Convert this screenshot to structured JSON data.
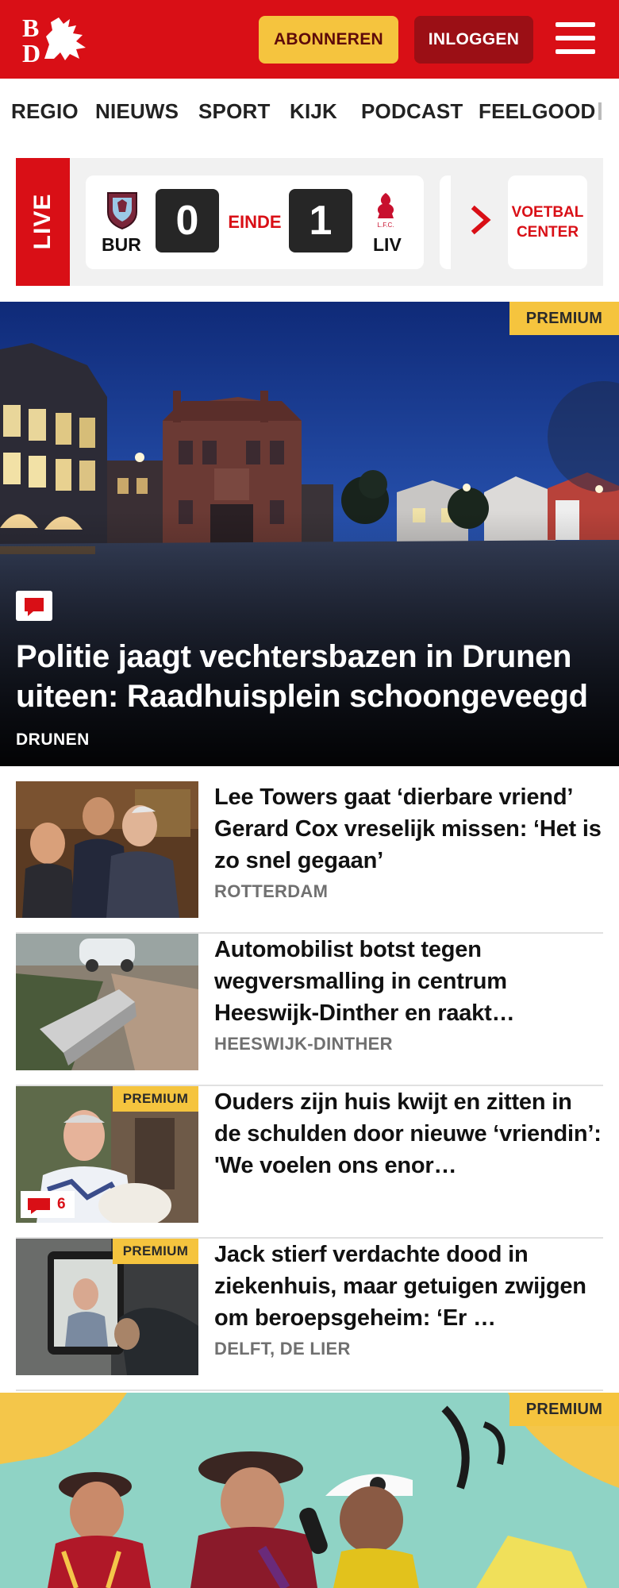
{
  "brand": {
    "logo_text": "BD",
    "accent": "#d90f16",
    "premium_color": "#f5c43e"
  },
  "header": {
    "subscribe_label": "ABONNEREN",
    "login_label": "INLOGGEN",
    "menu_icon": "hamburger-icon"
  },
  "nav": {
    "items": [
      "REGIO",
      "NIEUWS",
      "SPORT",
      "KIJK",
      "PODCAST",
      "FEELGOOD"
    ]
  },
  "live": {
    "label": "LIVE",
    "match": {
      "home": "BUR",
      "home_score": "0",
      "status": "EINDE",
      "away_score": "1",
      "away": "LIV"
    },
    "voetbal_center": "VOETBAL CENTER"
  },
  "hero": {
    "premium": "PREMIUM",
    "title": "Politie jaagt vechtersbazen in Drunen uiteen: Raadhuisplein schoongeveegd",
    "location": "DRUNEN"
  },
  "articles": [
    {
      "title": "Lee Towers gaat ‘dierbare vriend’ Gerard Cox vreselijk missen: ‘Het is zo snel gegaan’",
      "location": "ROTTERDAM"
    },
    {
      "title": "Automobilist botst tegen wegversmalling in centrum Heeswijk-Dinther en raakt…",
      "location": "HEESWIJK-DINTHER"
    },
    {
      "title": "Ouders zijn huis kwijt en zitten in de schulden door nieuwe ‘vriendin’: 'We voelen ons enor…",
      "location": "",
      "premium": "PREMIUM",
      "comments": "6"
    },
    {
      "title": "Jack stierf verdachte dood in ziekenhuis, maar getuigen zwijgen om beroepsgeheim: ‘Er …",
      "location": "DELFT, DE LIER",
      "premium": "PREMIUM"
    }
  ],
  "hero2": {
    "premium": "PREMIUM"
  }
}
